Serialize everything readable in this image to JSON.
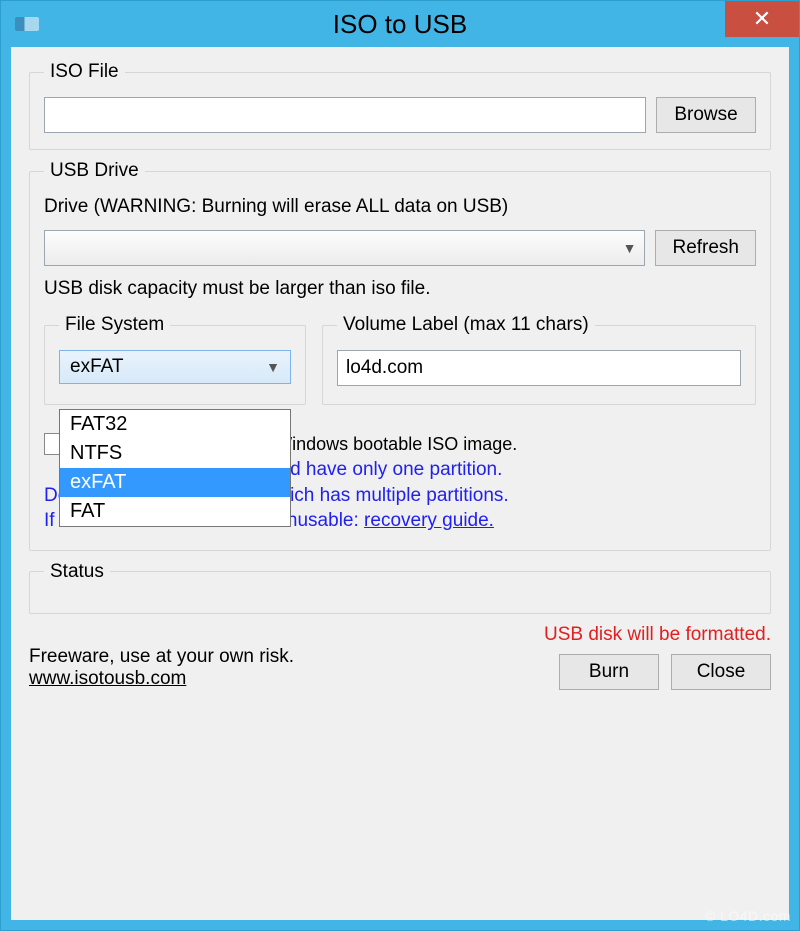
{
  "window": {
    "title": "ISO to USB",
    "close_label": "✕"
  },
  "iso": {
    "legend": "ISO File",
    "path": "",
    "browse": "Browse"
  },
  "usb": {
    "legend": "USB Drive",
    "drive_warning": "Drive (WARNING: Burning will erase ALL data on USB)",
    "drive_value": "",
    "refresh": "Refresh",
    "capacity_note": "USB disk capacity must be larger than iso file.",
    "fs_legend": "File System",
    "fs_selected": "exFAT",
    "fs_options": [
      "FAT32",
      "NTFS",
      "exFAT",
      "FAT"
    ],
    "vol_legend": "Volume Label (max 11 chars)",
    "vol_value": "lo4d.com",
    "bootable_label_suffix": "upports Windows bootable ISO image.",
    "warn_line1_suffix": " disk should have only one partition.",
    "warn_line2": "Do not use it on USB disk which has multiple partitions.",
    "warn_line3_prefix": "If create failed and USB be unusable: ",
    "recovery_link": "recovery guide."
  },
  "status": {
    "legend": "Status"
  },
  "footer": {
    "freeware": "Freeware, use at your own risk.",
    "site": "www.isotousb.com",
    "format_warn": "USB disk will be formatted.",
    "burn": "Burn",
    "close": "Close"
  },
  "watermark": "© LO4D.com"
}
